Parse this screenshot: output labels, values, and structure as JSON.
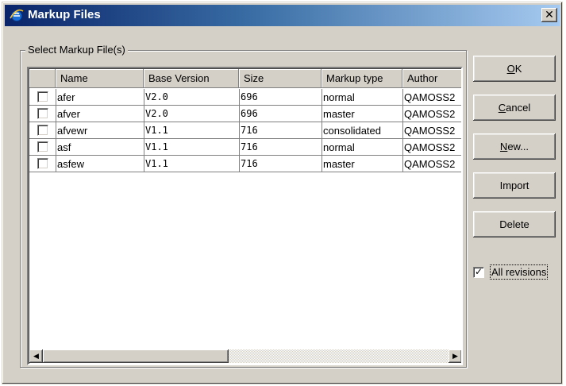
{
  "window": {
    "title": "Markup Files",
    "close_glyph": "✕"
  },
  "group": {
    "label": "Select Markup File(s)"
  },
  "table": {
    "columns": [
      "Name",
      "Base Version",
      "Size",
      "Markup type",
      "Author"
    ],
    "rows": [
      {
        "checked": false,
        "name": "afer",
        "base_version": "V2.0",
        "size": "696",
        "markup_type": "normal",
        "author": "QAMOSS2"
      },
      {
        "checked": false,
        "name": "afver",
        "base_version": "V2.0",
        "size": "696",
        "markup_type": "master",
        "author": "QAMOSS2"
      },
      {
        "checked": false,
        "name": "afvewr",
        "base_version": "V1.1",
        "size": "716",
        "markup_type": "consolidated",
        "author": "QAMOSS2"
      },
      {
        "checked": false,
        "name": "asf",
        "base_version": "V1.1",
        "size": "716",
        "markup_type": "normal",
        "author": "QAMOSS2"
      },
      {
        "checked": false,
        "name": "asfew",
        "base_version": "V1.1",
        "size": "716",
        "markup_type": "master",
        "author": "QAMOSS2"
      }
    ]
  },
  "buttons": {
    "ok": {
      "mnemonic": "O",
      "rest": "K"
    },
    "cancel": {
      "mnemonic": "C",
      "rest": "ancel"
    },
    "new": {
      "mnemonic": "N",
      "rest": "ew..."
    },
    "import": "Import",
    "delete": "Delete"
  },
  "all_revisions": {
    "checked": true,
    "label": "All revisions",
    "check_glyph": "✓"
  },
  "scroll": {
    "left_glyph": "◀",
    "right_glyph": "▶"
  }
}
